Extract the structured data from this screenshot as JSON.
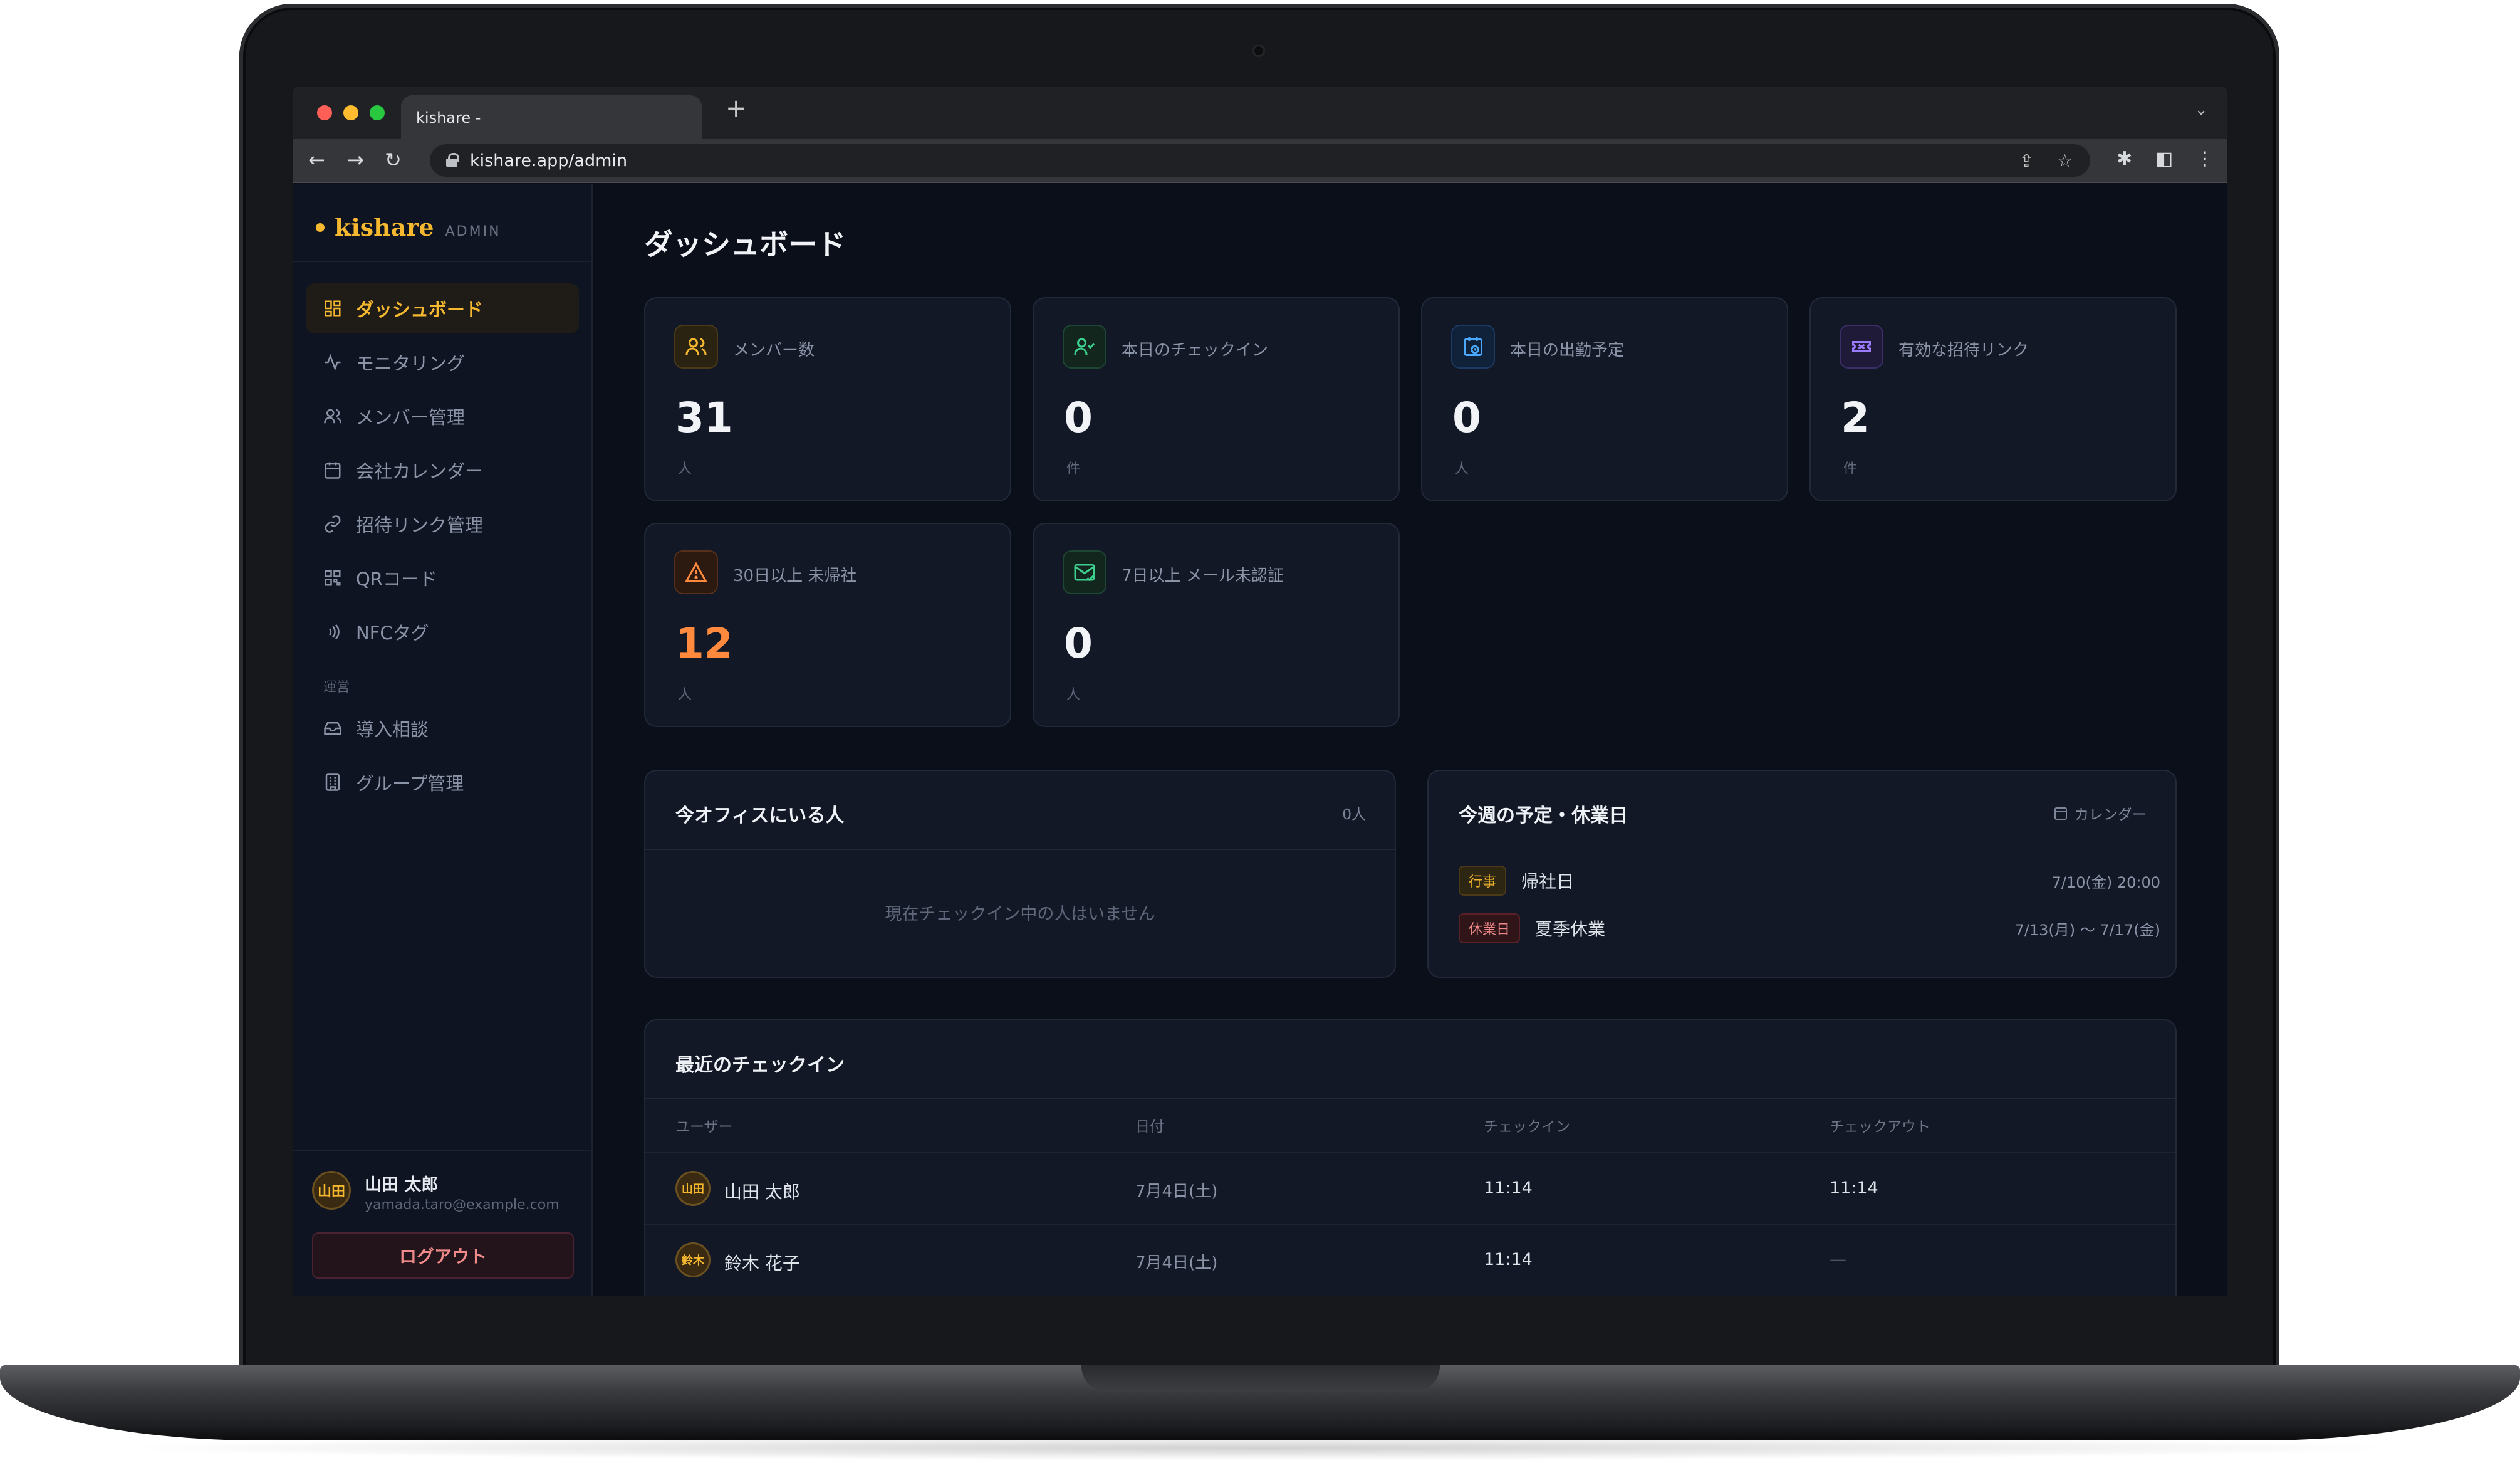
{
  "browser": {
    "tab_title": "kishare -",
    "url": "kishare.app/admin",
    "new_tab_glyph": "+",
    "tab_menu_glyph": "⌄"
  },
  "sidebar": {
    "brand": "kishare",
    "brand_sub": "ADMIN",
    "items": [
      {
        "label": "ダッシュボード",
        "icon": "dashboard-icon",
        "active": true
      },
      {
        "label": "モニタリング",
        "icon": "activity-icon"
      },
      {
        "label": "メンバー管理",
        "icon": "users-icon"
      },
      {
        "label": "会社カレンダー",
        "icon": "calendar-icon"
      },
      {
        "label": "招待リンク管理",
        "icon": "link-icon"
      },
      {
        "label": "QRコード",
        "icon": "qr-icon"
      },
      {
        "label": "NFCタグ",
        "icon": "nfc-icon"
      }
    ],
    "section_label": "運営",
    "ops_items": [
      {
        "label": "導入相談",
        "icon": "inbox-icon"
      },
      {
        "label": "グループ管理",
        "icon": "building-icon"
      }
    ],
    "user": {
      "avatar": "山田",
      "name": "山田 太郎",
      "email": "yamada.taro@example.com",
      "logout": "ログアウト"
    }
  },
  "main": {
    "title": "ダッシュボード",
    "stats": [
      {
        "label": "メンバー数",
        "value": "31",
        "unit": "人",
        "icon": "users-icon",
        "accent": "#f5b82e"
      },
      {
        "label": "本日のチェックイン",
        "value": "0",
        "unit": "件",
        "icon": "user-check-icon",
        "accent": "#3ccf8e"
      },
      {
        "label": "本日の出勤予定",
        "value": "0",
        "unit": "人",
        "icon": "calendar-clock-icon",
        "accent": "#4aa8ff"
      },
      {
        "label": "有効な招待リンク",
        "value": "2",
        "unit": "件",
        "icon": "ticket-icon",
        "accent": "#9b7bff"
      },
      {
        "label": "30日以上 未帰社",
        "value": "12",
        "unit": "人",
        "icon": "warning-icon",
        "accent": "#ff8a3d"
      },
      {
        "label": "7日以上 メール未認証",
        "value": "0",
        "unit": "人",
        "icon": "mail-check-icon",
        "accent": "#3ccf8e"
      }
    ],
    "office": {
      "title": "今オフィスにいる人",
      "count": "0人",
      "empty": "現在チェックイン中の人はいません"
    },
    "schedule": {
      "title": "今週の予定・休業日",
      "link": "カレンダー",
      "events": [
        {
          "badge": "行事",
          "title": "帰社日",
          "date": "7/10(金) 20:00",
          "kind": "event"
        },
        {
          "badge": "休業日",
          "title": "夏季休業",
          "date": "7/13(月) 〜 7/17(金)",
          "kind": "holiday"
        }
      ]
    },
    "recent": {
      "title": "最近のチェックイン",
      "columns": [
        "ユーザー",
        "日付",
        "チェックイン",
        "チェックアウト"
      ],
      "rows": [
        {
          "avatar": "山田",
          "name": "山田 太郎",
          "date": "7月4日(土)",
          "in": "11:14",
          "out": "11:14"
        },
        {
          "avatar": "鈴木",
          "name": "鈴木 花子",
          "date": "7月4日(土)",
          "in": "11:14",
          "out": "—"
        }
      ]
    }
  }
}
